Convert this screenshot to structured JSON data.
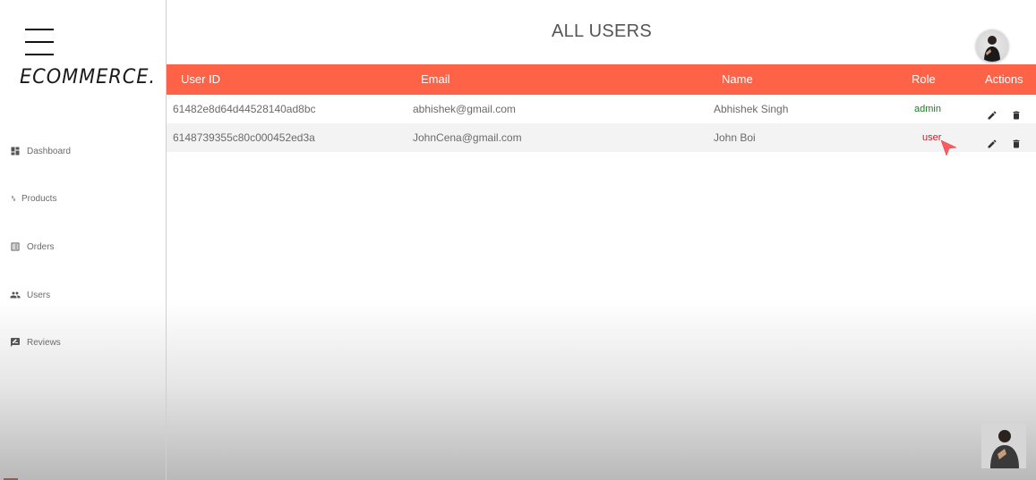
{
  "app": {
    "logo": "ECOMMERCE."
  },
  "sidebar": {
    "items": [
      {
        "label": "Dashboard",
        "icon": "dashboard-icon"
      },
      {
        "label": "Products",
        "icon": "import-export-icon"
      },
      {
        "label": "Orders",
        "icon": "list-alt-icon"
      },
      {
        "label": "Users",
        "icon": "people-icon"
      },
      {
        "label": "Reviews",
        "icon": "rate-review-icon"
      }
    ]
  },
  "page": {
    "title": "ALL USERS"
  },
  "table": {
    "columns": [
      "User ID",
      "Email",
      "Name",
      "Role",
      "Actions"
    ],
    "rows": [
      {
        "id": "61482e8d64d44528140ad8bc",
        "email": "abhishek@gmail.com",
        "name": "Abhishek Singh",
        "role": "admin"
      },
      {
        "id": "6148739355c80c000452ed3a",
        "email": "JohnCena@gmail.com",
        "name": "John Boi",
        "role": "user"
      }
    ]
  },
  "colors": {
    "header": "#ff6347",
    "admin_role": "#1e7e22",
    "user_role": "#c0222c"
  }
}
